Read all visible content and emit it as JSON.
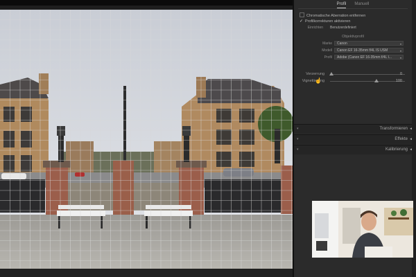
{
  "panel": {
    "tabs": [
      "Profil",
      "Manuell"
    ],
    "checkboxes": {
      "remove_ca": "Chromatische Aberration entfernen",
      "enable_profile": "Profilkorrekturen aktivieren"
    },
    "setup_label": "Einrichten",
    "setup_value": "Benutzerdefiniert",
    "lens_profile_heading": "Objektivprofil",
    "rows": [
      {
        "label": "Marke",
        "value": "Canon"
      },
      {
        "label": "Modell",
        "value": "Canon EF 16-35mm f/4L IS USM"
      },
      {
        "label": "Profil",
        "value": "Adobe (Canon EF 16-35mm f/4L I..."
      }
    ],
    "sliders": [
      {
        "label": "Verzerrung",
        "value": "0",
        "fraction": 0.02
      },
      {
        "label": "Vignettierung",
        "value": "100",
        "fraction": 0.62
      }
    ],
    "sections": [
      {
        "label": "Transformieren"
      },
      {
        "label": "Effekte"
      },
      {
        "label": "Kalibrierung"
      }
    ]
  },
  "colors": {
    "panel_bg": "#2b2b2b",
    "section_bg": "#252525",
    "grid_line": "#d8d8d8"
  },
  "icons": {
    "dropdown": "dropdown-arrow-icon",
    "section_toggle": "section-toggle-icon",
    "cursor": "pointer-cursor-icon"
  }
}
